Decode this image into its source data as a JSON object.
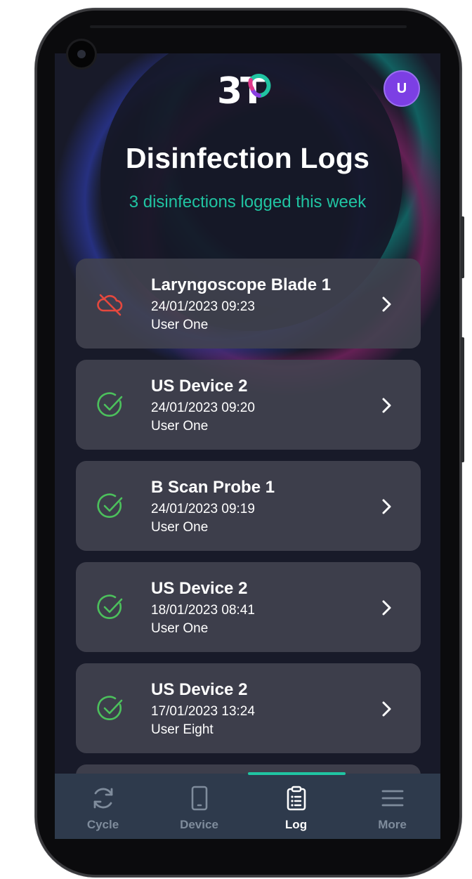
{
  "app": {
    "logo_text": "3T",
    "avatar_initial": "U",
    "title": "Disinfection Logs",
    "subtitle": "3 disinfections logged this week"
  },
  "colors": {
    "accent": "#20c4a2",
    "success": "#4cc05c",
    "failure": "#e5483e",
    "avatar": "#7c3fe4",
    "card": "#424350",
    "nav_bg": "#2e3a4c"
  },
  "logs": [
    {
      "name": "Laryngoscope Blade 1",
      "date": "24/01/2023 09:23",
      "user": "User One",
      "status": "failed",
      "icon": "cloud-off-icon"
    },
    {
      "name": "US Device 2",
      "date": "24/01/2023 09:20",
      "user": "User One",
      "status": "success",
      "icon": "check-circle-icon"
    },
    {
      "name": "B Scan Probe 1",
      "date": "24/01/2023 09:19",
      "user": "User One",
      "status": "success",
      "icon": "check-circle-icon"
    },
    {
      "name": "US Device 2",
      "date": "18/01/2023 08:41",
      "user": "User One",
      "status": "success",
      "icon": "check-circle-icon"
    },
    {
      "name": "US Device 2",
      "date": "17/01/2023 13:24",
      "user": "User Eight",
      "status": "success",
      "icon": "check-circle-icon"
    }
  ],
  "nav": [
    {
      "label": "Cycle",
      "icon": "refresh-icon",
      "active": false
    },
    {
      "label": "Device",
      "icon": "phone-icon",
      "active": false
    },
    {
      "label": "Log",
      "icon": "clipboard-icon",
      "active": true
    },
    {
      "label": "More",
      "icon": "menu-icon",
      "active": false
    }
  ]
}
